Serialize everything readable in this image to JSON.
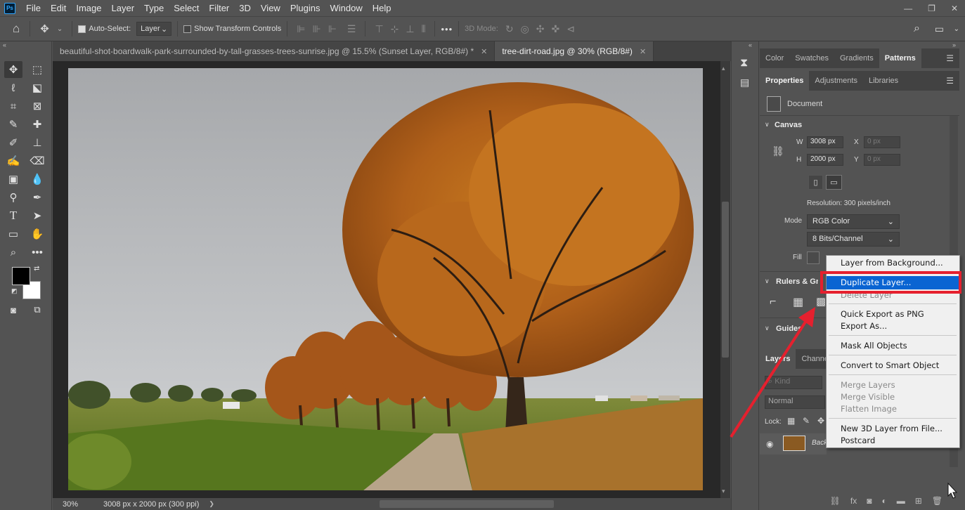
{
  "menubar": {
    "logo": "Ps",
    "items": [
      "File",
      "Edit",
      "Image",
      "Layer",
      "Type",
      "Select",
      "Filter",
      "3D",
      "View",
      "Plugins",
      "Window",
      "Help"
    ],
    "window_buttons": [
      "—",
      "❐",
      "✕"
    ]
  },
  "options_bar": {
    "auto_select_label": "Auto-Select:",
    "auto_select_checked": true,
    "layer_select": "Layer",
    "show_transform_label": "Show Transform Controls",
    "three_d_mode_label": "3D Mode:",
    "more": "•••"
  },
  "tabs": [
    {
      "title": "beautiful-shot-boardwalk-park-surrounded-by-tall-grasses-trees-sunrise.jpg @ 15.5% (Sunset Layer, RGB/8#) *",
      "close": "✕"
    },
    {
      "title": "tree-dirt-road.jpg @ 30% (RGB/8#)",
      "close": "✕"
    }
  ],
  "status": {
    "zoom": "30%",
    "doc_size": "3008 px x 2000 px (300 ppi)",
    "arrow": "❯"
  },
  "panels": {
    "top_tabs": [
      "Color",
      "Swatches",
      "Gradients",
      "Patterns"
    ],
    "active_top_tab": "Patterns",
    "prop_tabs": [
      "Properties",
      "Adjustments",
      "Libraries"
    ],
    "document_label": "Document",
    "canvas_section": "Canvas",
    "w_label": "W",
    "w_value": "3008 px",
    "h_label": "H",
    "h_value": "2000 px",
    "x_label": "X",
    "x_placeholder": "0 px",
    "y_label": "Y",
    "y_placeholder": "0 px",
    "resolution": "Resolution: 300 pixels/inch",
    "mode_label": "Mode",
    "mode_value": "RGB Color",
    "bits_value": "8 Bits/Channel",
    "fill_label": "Fill",
    "rulers_section": "Rulers & Grid",
    "guides_section": "Guides",
    "layer_tabs": [
      "Layers",
      "Channels"
    ],
    "kind_placeholder": "Kind",
    "blend_mode": "Normal",
    "lock_label": "Lock:",
    "layer_name": "Background"
  },
  "context_menu": {
    "items": [
      {
        "label": "Layer from Background...",
        "enabled": true
      },
      {
        "label": "Duplicate Layer...",
        "enabled": true,
        "highlighted": true
      },
      {
        "label": "Delete Layer",
        "enabled": false
      },
      {
        "label": "Quick Export as PNG",
        "enabled": true
      },
      {
        "label": "Export As...",
        "enabled": true
      },
      {
        "label": "Mask All Objects",
        "enabled": true
      },
      {
        "label": "Convert to Smart Object",
        "enabled": true
      },
      {
        "label": "Merge Layers",
        "enabled": false
      },
      {
        "label": "Merge Visible",
        "enabled": false
      },
      {
        "label": "Flatten Image",
        "enabled": false
      },
      {
        "label": "New 3D Layer from File...",
        "enabled": true
      },
      {
        "label": "Postcard",
        "enabled": true
      }
    ]
  },
  "colors": {
    "accent_highlight": "#0a64d2",
    "annotation_red": "#e5202e",
    "ui_bg": "#535353",
    "canvas_bg": "#282828"
  }
}
